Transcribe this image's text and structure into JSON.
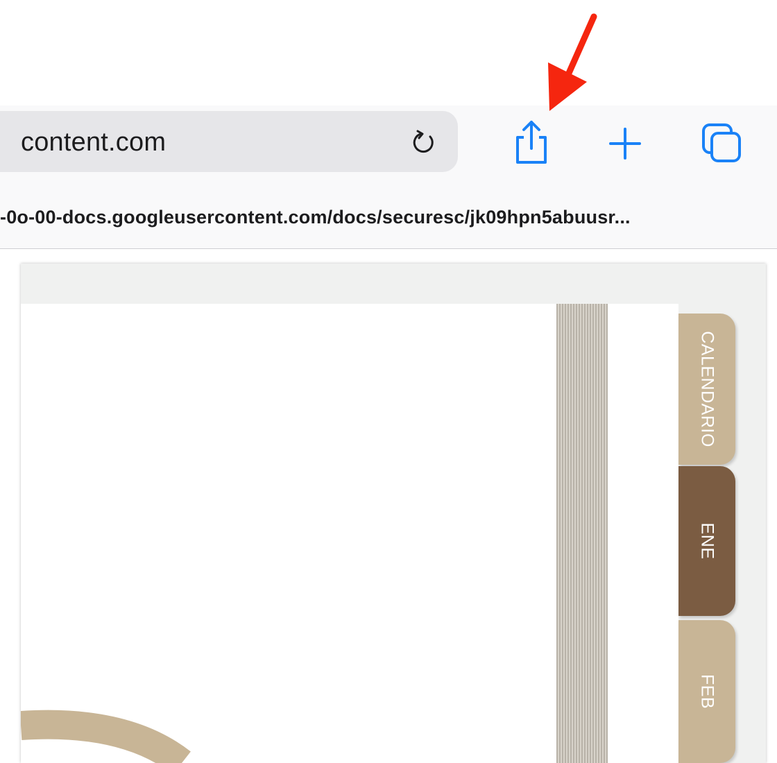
{
  "browser": {
    "url_short": "content.com",
    "url_full": "-0o-00-docs.googleusercontent.com/docs/securesc/jk09hpn5abuusr..."
  },
  "toolbar": {
    "icons": [
      "reload-icon",
      "share-icon",
      "plus-icon",
      "tabs-icon"
    ],
    "accent_color": "#1a82f7"
  },
  "document": {
    "tabs": [
      {
        "label": "CALENDARIO",
        "color": "#c8b596"
      },
      {
        "label": "ENE",
        "color": "#7b5c42"
      },
      {
        "label": "FEB",
        "color": "#c8b596"
      }
    ]
  },
  "annotation": {
    "arrow_color": "#f5260f"
  }
}
